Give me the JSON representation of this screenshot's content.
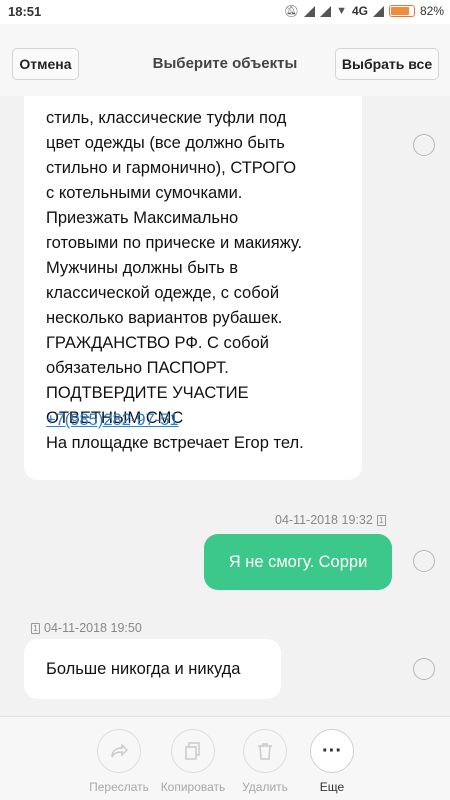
{
  "status_bar": {
    "time": "18:51",
    "network": "4G",
    "battery_percent": "82%",
    "battery_level": 0.82,
    "icons": [
      "mute-icon",
      "signal-icon",
      "signal-icon",
      "wifi-icon",
      "signal-icon",
      "battery-icon"
    ]
  },
  "header": {
    "cancel_label": "Отмена",
    "title": "Выберите объекты",
    "select_all_label": "Выбрать все"
  },
  "messages": {
    "incoming_long": {
      "text": "стиль, классические туфли под\nцвет одежды (все должно быть\nстильно и гармонично), СТРОГО\nс котельными сумочками.\nПриезжать Максимально\nготовыми по прическе и макияжу.\nМужчины должны быть в\nклассической одежде, с собой\nнесколько вариантов рубашек.\nГРАЖДАНСТВО РФ. С собой\nобязательно ПАСПОРТ.\nПОДТВЕРДИТЕ УЧАСТИЕ\nОТВЕТНЫМ СМС\nНа площадке встречает Егор тел.",
      "phone_link": "+7(985)282-97-51"
    },
    "outgoing": {
      "timestamp": "04-11-2018 19:32",
      "sim": "1",
      "text": "Я не смогу. Сорри"
    },
    "incoming_short": {
      "timestamp": "04-11-2018 19:50",
      "sim": "1",
      "text": "Больше никогда и никуда"
    }
  },
  "toolbar": {
    "forward_label": "Переслать",
    "copy_label": "Копировать",
    "delete_label": "Удалить",
    "more_label": "Еще",
    "more_glyph": "···"
  },
  "colors": {
    "outgoing_bubble": "#3cc78b",
    "link": "#2a7fd4",
    "battery": "#f28a3c"
  }
}
